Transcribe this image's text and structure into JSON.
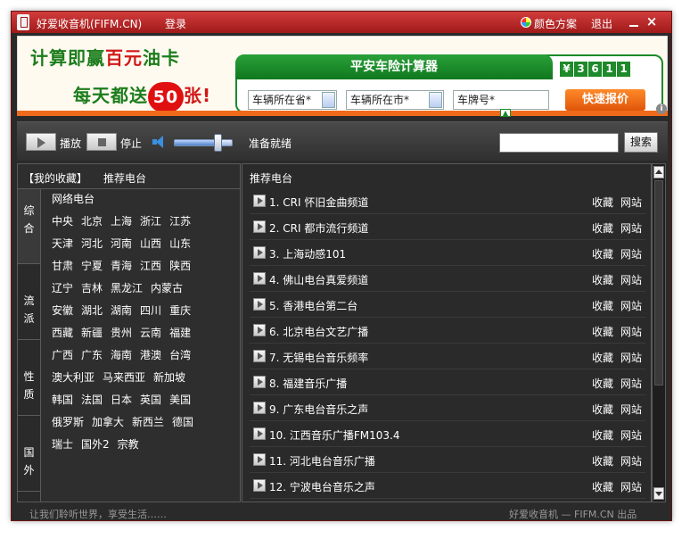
{
  "titlebar": {
    "app_title": "好爱收音机(FIFM.CN)",
    "login": "登录",
    "color_scheme": "颜色方案",
    "exit": "退出",
    "close": "×"
  },
  "banner": {
    "line1_pre": "计算即赢",
    "line1_red": "百元",
    "line1_post": "油卡",
    "line2_pre": "每天都送",
    "line2_badge": "50",
    "line2_red": "张!",
    "calc_title": "平安车险计算器",
    "money_digits": [
      "¥",
      "3",
      "6",
      "1",
      "1"
    ],
    "field_province": "车辆所在省*",
    "field_city": "车辆所在市*",
    "field_plate": "车牌号*",
    "quote_button": "快速报价"
  },
  "player": {
    "play": "播放",
    "stop": "停止",
    "status": "准备就绪",
    "search_value": "",
    "search_button": "搜索",
    "volume_level": 0.75
  },
  "left": {
    "tab_favorites": "【我的收藏】",
    "tab_recommended": "推荐电台",
    "categories": [
      {
        "label": [
          "综",
          "合"
        ]
      },
      {
        "label": [
          "流",
          "派"
        ]
      },
      {
        "label": [
          "性",
          "质"
        ]
      },
      {
        "label": [
          "国",
          "外"
        ]
      }
    ],
    "regions": [
      [
        "网络电台"
      ],
      [
        "中央",
        "北京",
        "上海",
        "浙江",
        "江苏"
      ],
      [
        "天津",
        "河北",
        "河南",
        "山西",
        "山东"
      ],
      [
        "甘肃",
        "宁夏",
        "青海",
        "江西",
        "陕西"
      ],
      [
        "辽宁",
        "吉林",
        "黑龙江",
        "内蒙古"
      ],
      [
        "安徽",
        "湖北",
        "湖南",
        "四川",
        "重庆"
      ],
      [
        "西藏",
        "新疆",
        "贵州",
        "云南",
        "福建"
      ],
      [
        "广西",
        "广东",
        "海南",
        "港澳",
        "台湾"
      ],
      [
        "澳大利亚",
        "马来西亚",
        "新加坡"
      ],
      [
        "韩国",
        "法国",
        "日本",
        "英国",
        "美国"
      ],
      [
        "俄罗斯",
        "加拿大",
        "新西兰",
        "德国"
      ],
      [
        "瑞士",
        "国外2",
        "宗教"
      ]
    ]
  },
  "right": {
    "title": "推荐电台",
    "fav_label": "收藏",
    "site_label": "网站",
    "stations": [
      "1. CRI 怀旧金曲频道",
      "2. CRI 都市流行频道",
      "3. 上海动感101",
      "4. 佛山电台真爱频道",
      "5. 香港电台第二台",
      "6. 北京电台文艺广播",
      "7. 无锡电台音乐频率",
      "8. 福建音乐广播",
      "9. 广东电台音乐之声",
      "10. 江西音乐广播FM103.4",
      "11. 河北电台音乐广播",
      "12. 宁波电台音乐之声"
    ]
  },
  "statusbar": {
    "left": "让我们聆听世界，享受生活……",
    "right": "好爱收音机 — FIFM.CN 出品"
  }
}
